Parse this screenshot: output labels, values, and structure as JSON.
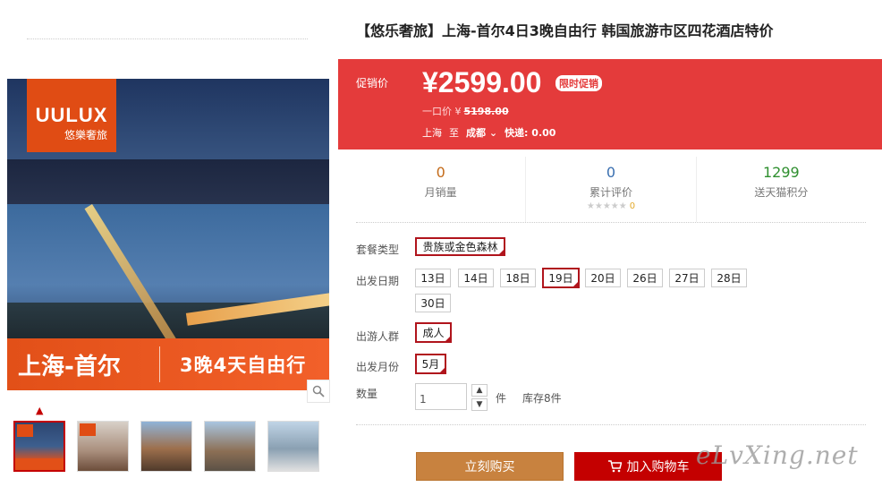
{
  "gallery": {
    "logo_en": "UULUX",
    "logo_cn": "悠樂奢旅",
    "banner_route": "上海-首尔",
    "banner_plan": "3晚4天自由行",
    "zoom_icon": "magnifier-icon",
    "thumbnails": [
      "thumb-1",
      "thumb-2",
      "thumb-3",
      "thumb-4",
      "thumb-5"
    ]
  },
  "product": {
    "title": "【悠乐奢旅】上海-首尔4日3晚自由行 韩国旅游市区四花酒店特价"
  },
  "promo": {
    "label": "促销价",
    "price": "¥2599.00",
    "badge": "限时促销",
    "orig_label": "一口价 ¥",
    "orig_value": "5198.00",
    "from": "上海",
    "to_word": "至",
    "to_city": "成都",
    "shipping": "快递: 0.00",
    "bg_color": "#e43b3b"
  },
  "stats": [
    {
      "num": "0",
      "label": "月销量"
    },
    {
      "num": "0",
      "label": "累计评价",
      "stars": "★★★★★",
      "rating": "0"
    },
    {
      "num": "1299",
      "label": "送天猫积分"
    }
  ],
  "options": {
    "package_label": "套餐类型",
    "package_values": [
      "贵族或金色森林"
    ],
    "date_label": "出发日期",
    "dates": [
      "13日",
      "14日",
      "18日",
      "19日",
      "20日",
      "26日",
      "27日",
      "28日",
      "30日"
    ],
    "crowd_label": "出游人群",
    "crowd_values": [
      "成人"
    ],
    "month_label": "出发月份",
    "month_values": [
      "5月"
    ],
    "qty_label": "数量",
    "qty_value": "1",
    "qty_unit": "件",
    "stock": "库存8件"
  },
  "actions": {
    "buy": "立刻购买",
    "cart": "加入购物车"
  },
  "watermark": "eLvXing.net"
}
